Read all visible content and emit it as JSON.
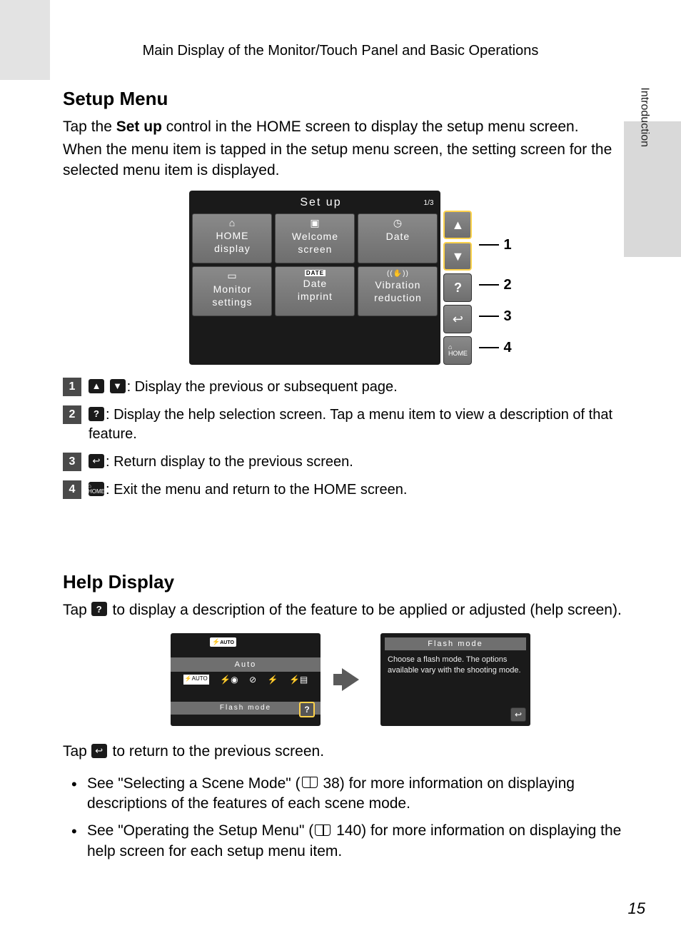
{
  "header": "Main Display of the Monitor/Touch Panel and Basic Operations",
  "side_tab": "Introduction",
  "section1": {
    "title": "Setup Menu",
    "p1_a": "Tap the ",
    "p1_bold": "Set up",
    "p1_b": " control in the HOME screen to display the setup menu screen.",
    "p2": "When the menu item is tapped in the setup menu screen, the setting screen for the selected menu item is displayed."
  },
  "setup_screen": {
    "title": "Set up",
    "page": "1/3",
    "cells": [
      {
        "icon": "⌂",
        "l1": "HOME",
        "l2": "display"
      },
      {
        "icon": "▣",
        "l1": "Welcome",
        "l2": "screen"
      },
      {
        "icon": "◷",
        "l1": "Date",
        "l2": ""
      },
      {
        "icon": "▭",
        "l1": "Monitor",
        "l2": "settings"
      },
      {
        "icon": "DATE",
        "l1": "Date",
        "l2": "imprint"
      },
      {
        "icon": "((✋))",
        "l1": "Vibration",
        "l2": "reduction"
      }
    ]
  },
  "callouts": [
    "1",
    "2",
    "3",
    "4"
  ],
  "legend": [
    {
      "n": "1",
      "icons": [
        "▲",
        "▼"
      ],
      "text": ": Display the previous or subsequent page."
    },
    {
      "n": "2",
      "icons": [
        "?"
      ],
      "text": ": Display the help selection screen. Tap a menu item to view a description of that feature."
    },
    {
      "n": "3",
      "icons": [
        "↩"
      ],
      "text": ": Return display to the previous screen."
    },
    {
      "n": "4",
      "icons": [
        "⌂"
      ],
      "text": ": Exit the menu and return to the HOME screen."
    }
  ],
  "section2": {
    "title": "Help Display",
    "p1_a": "Tap ",
    "p1_b": " to display a description of the feature to be applied or adjusted (help screen).",
    "p2_a": "Tap ",
    "p2_b": " to return to the previous screen."
  },
  "help_a": {
    "auto_label": "Auto",
    "flash_label": "Flash mode"
  },
  "help_b": {
    "title": "Flash mode",
    "body": "Choose a flash mode. The options available vary with the shooting mode."
  },
  "bullets": [
    {
      "a": "See \"Selecting a Scene Mode\" (",
      "ref": "38",
      "b": ") for more information on displaying descriptions of the features of each scene mode."
    },
    {
      "a": "See \"Operating the Setup Menu\" (",
      "ref": "140",
      "b": ") for more information on displaying the help screen for each setup menu item."
    }
  ],
  "page_number": "15"
}
